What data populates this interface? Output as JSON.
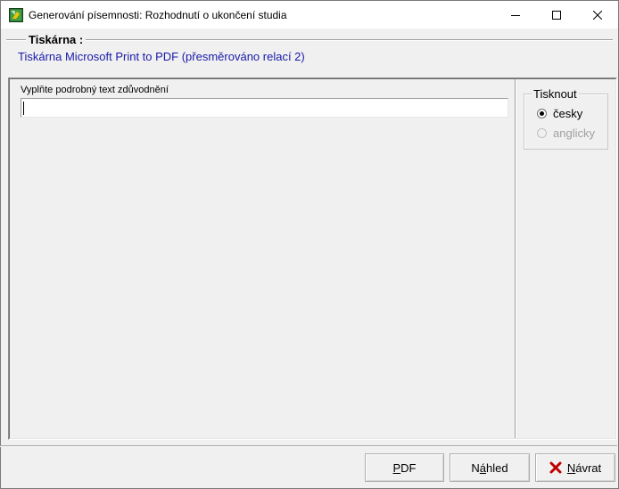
{
  "window": {
    "title": "Generování písemnosti: Rozhodnutí o ukončení studia",
    "icon": "app-icon",
    "controls": [
      "minimize-icon",
      "maximize-icon",
      "close-icon"
    ]
  },
  "printer": {
    "label": "Tiskárna :",
    "name": "Tiskárna Microsoft Print to PDF (přesměrováno relací 2)",
    "name_color": "#1a1aa8"
  },
  "reason": {
    "label": "Vyplňte podrobný text zdůvodnění",
    "value": ""
  },
  "print_group": {
    "label": "Tisknout",
    "options": [
      {
        "label": "česky",
        "checked": true,
        "enabled": true
      },
      {
        "label": "anglicky",
        "checked": false,
        "enabled": false
      }
    ]
  },
  "buttons": {
    "pdf": {
      "mnemonic": "P",
      "rest": "DF"
    },
    "preview": {
      "pre": "N",
      "mnemonic": "á",
      "rest": "hled"
    },
    "back": {
      "mnemonic": "N",
      "rest": "ávrat",
      "icon": "red-x-icon",
      "icon_color": "#c00000"
    }
  }
}
